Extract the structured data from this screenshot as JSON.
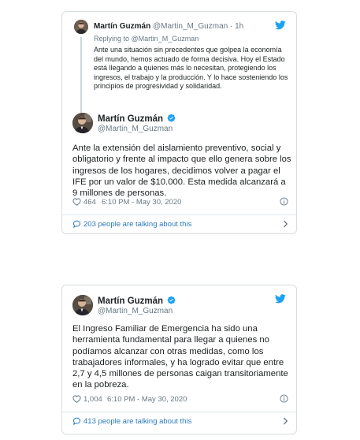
{
  "colors": {
    "link_blue": "#2b7bb9",
    "twitter_blue": "#1da1f2",
    "muted": "#697882",
    "border": "#d7dde2"
  },
  "tweet1": {
    "context": {
      "name": "Martín Guzmán",
      "handle": "@Martin_M_Guzman",
      "separator": "·",
      "age": "1h",
      "replying_prefix": "Replying to",
      "replying_to": "@Martin_M_Guzman",
      "text": "Ante una situación sin precedentes que golpea la economía del mundo, hemos actuado de forma decisiva. Hoy el Estado está llegando a quienes más lo necesitan, protegiendo los ingresos, el trabajo y la producción. Y lo hace sosteniendo los principios de progresividad y solidaridad."
    },
    "author": {
      "name": "Martín Guzmán",
      "handle": "@Martin_M_Guzman"
    },
    "text": "Ante la extensión del aislamiento preventivo, social y obligatorio y frente al impacto que ello genera sobre los ingresos de los hogares, decidimos volver a pagar el IFE por un valor de $10.000. Esta medida alcanzará a 9 millones de personas.",
    "likes": "464",
    "timestamp": "6:10 PM - May 30, 2020",
    "talking": "203 people are talking about this"
  },
  "tweet2": {
    "author": {
      "name": "Martín Guzmán",
      "handle": "@Martin_M_Guzman"
    },
    "text": "El Ingreso Familiar de Emergencia ha sido una herramienta fundamental para llegar a quienes no podíamos alcanzar con otras medidas, como los trabajadores informales, y ha logrado evitar que entre 2,7 y 4,5 millones de personas caigan transitoriamente en la pobreza.",
    "likes": "1,004",
    "timestamp": "6:10 PM - May 30, 2020",
    "talking": "413 people are talking about this"
  }
}
